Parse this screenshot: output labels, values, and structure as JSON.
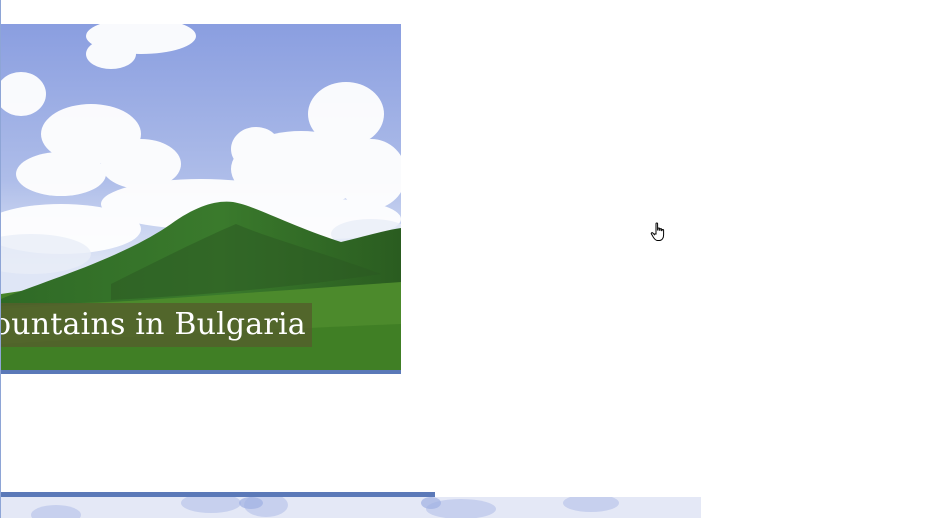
{
  "hero": {
    "caption": "ountains in Bulgaria",
    "image": "mountain-landscape-photo"
  },
  "next_card": {
    "image": "sky-clouds-photo"
  },
  "cursor": {
    "icon": "hand-pointer-icon"
  },
  "colors": {
    "accent": "#5b79b8",
    "caption_bg": "#535f2c",
    "caption_text": "#ffffff",
    "page_bg": "#ffffff"
  }
}
